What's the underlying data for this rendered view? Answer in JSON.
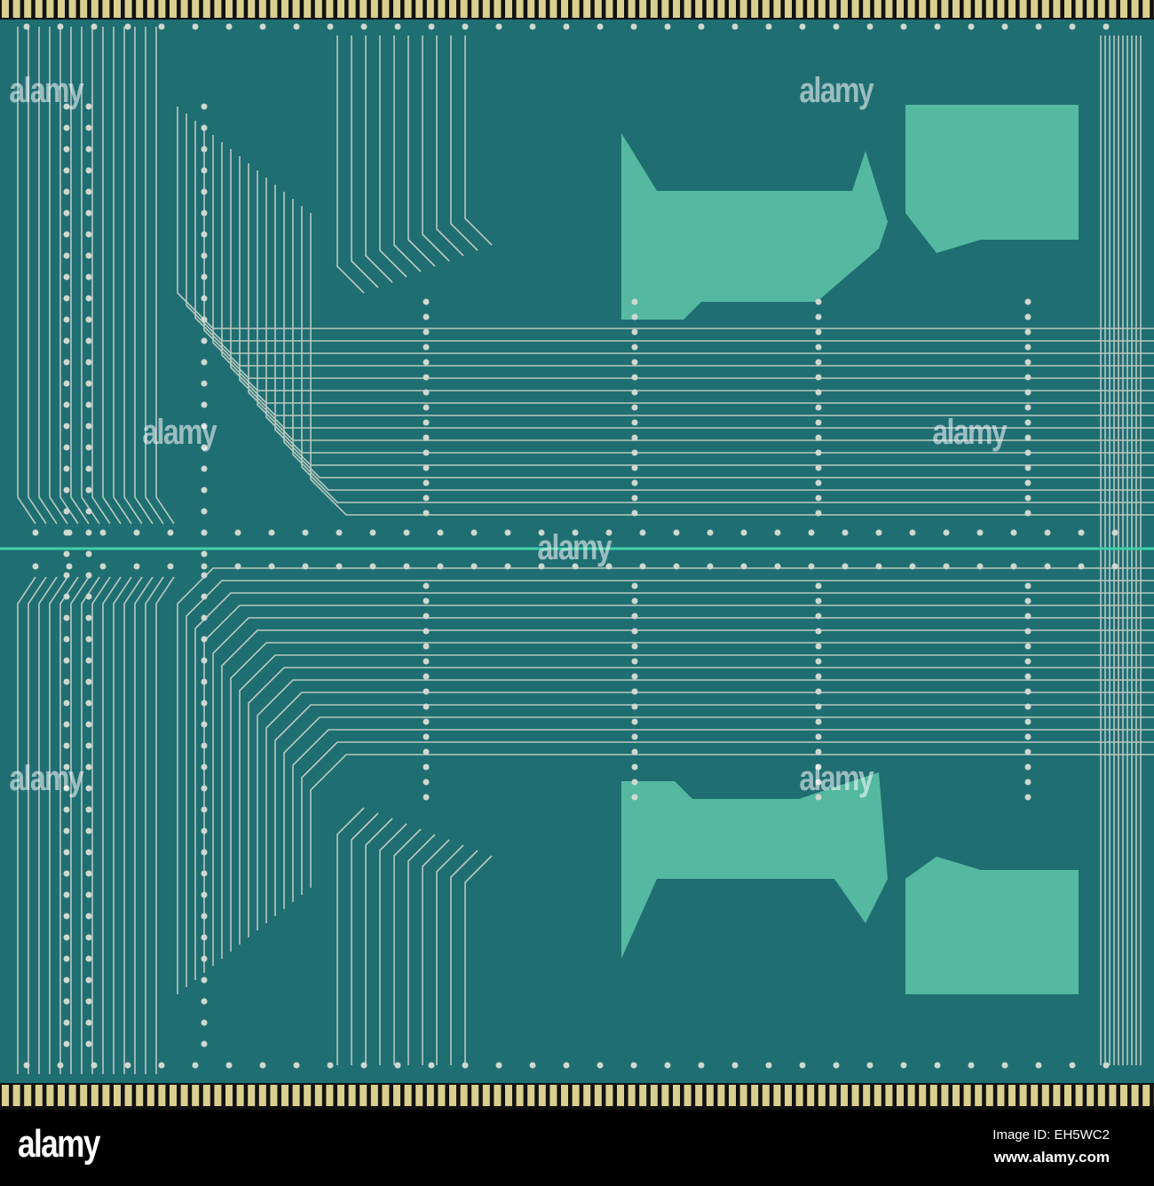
{
  "photo": {
    "subject": "Green printed circuit board with gold edge connector contacts",
    "colors": {
      "board": "#1e6f73",
      "board_dark": "#155a60",
      "pad": "#52b8a0",
      "trace": "#b5c7bd",
      "gold": "#d9cf8f"
    }
  },
  "watermark": {
    "text": "alamy"
  },
  "footer": {
    "logo": "alamy",
    "image_id": "Image ID: EH5WC2",
    "website": "www.alamy.com"
  }
}
